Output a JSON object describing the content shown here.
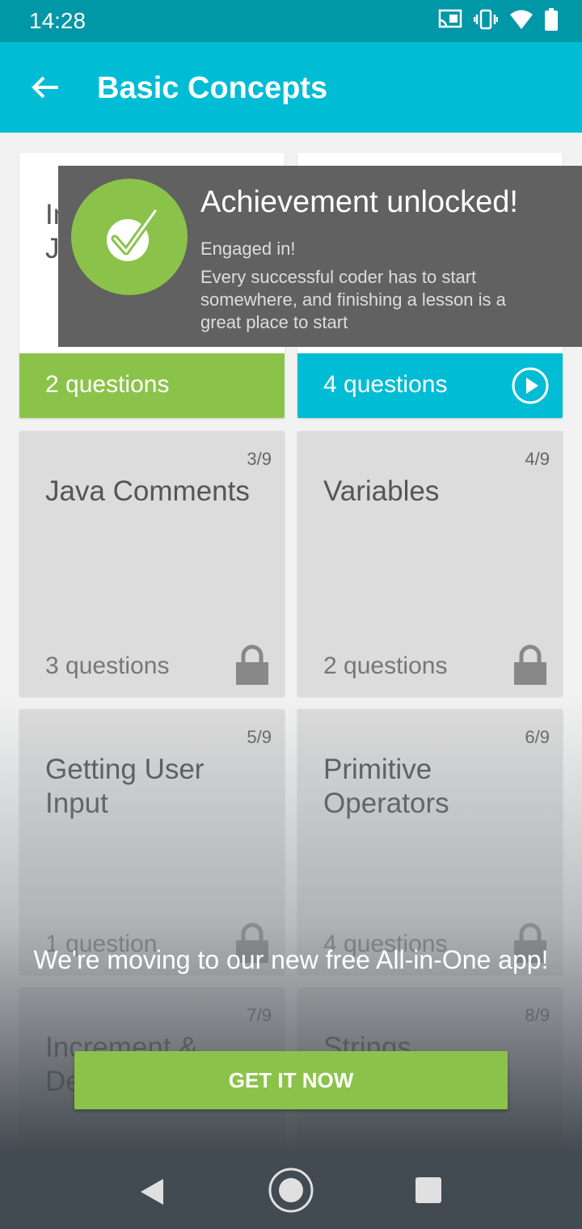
{
  "status": {
    "time": "14:28"
  },
  "appbar": {
    "title": "Basic Concepts"
  },
  "cards": [
    {
      "title": "In\nJ",
      "questions": "2 questions"
    },
    {
      "title": "",
      "questions": "4 questions"
    },
    {
      "num": "3/9",
      "title": "Java Comments",
      "questions": "3 questions"
    },
    {
      "num": "4/9",
      "title": "Variables",
      "questions": "2 questions"
    },
    {
      "num": "5/9",
      "title": "Getting User Input",
      "questions": "1 question"
    },
    {
      "num": "6/9",
      "title": "Primitive Operators",
      "questions": "4 questions"
    },
    {
      "num": "7/9",
      "title": "Increment & De"
    },
    {
      "num": "8/9",
      "title": "Strings"
    }
  ],
  "toast": {
    "title": "Achievement unlocked!",
    "subtitle": "Engaged in!",
    "body": "Every successful coder has to start somewhere, and finishing a lesson is a great place to start"
  },
  "promo": {
    "text": "We're moving to our new free All-in-One app!",
    "button": "GET IT NOW"
  },
  "colors": {
    "appbar": "#00bcd4",
    "statusbar": "#0097a7",
    "accent_green": "#8bc34a",
    "toast": "#616161"
  }
}
